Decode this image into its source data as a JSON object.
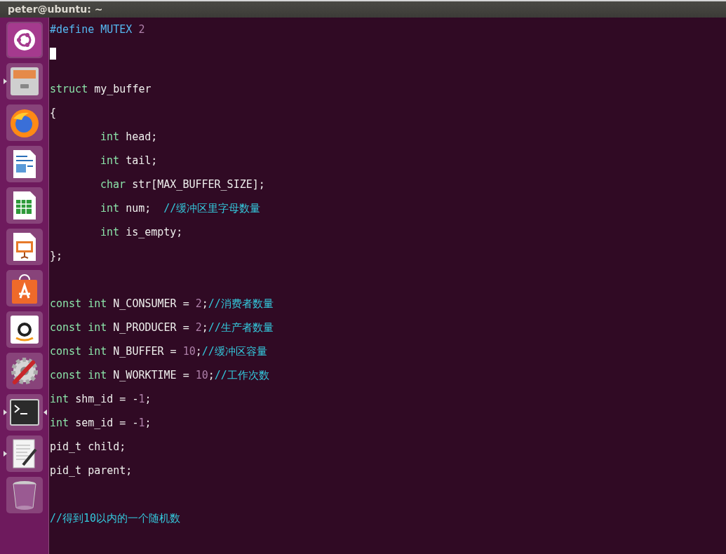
{
  "window": {
    "title": "peter@ubuntu: ~"
  },
  "launcher": [
    {
      "kind": "logo",
      "running": false,
      "focused": false
    },
    {
      "kind": "cabinet",
      "running": true,
      "focused": false
    },
    {
      "kind": "globe",
      "running": false,
      "focused": false
    },
    {
      "kind": "document",
      "running": false,
      "focused": false
    },
    {
      "kind": "spreadsheet",
      "running": false,
      "focused": false
    },
    {
      "kind": "presentation",
      "running": false,
      "focused": false
    },
    {
      "kind": "bag",
      "running": false,
      "focused": false
    },
    {
      "kind": "letter",
      "running": false,
      "focused": false
    },
    {
      "kind": "settings",
      "running": false,
      "focused": false
    },
    {
      "kind": "terminal",
      "running": true,
      "focused": true
    },
    {
      "kind": "editor",
      "running": true,
      "focused": false
    },
    {
      "kind": "trash",
      "running": false,
      "focused": false
    }
  ],
  "editor": {
    "lines": [
      {
        "kind": "code",
        "indented": false,
        "tokens": [
          {
            "kind": "preproc",
            "text": "#define MUTEX"
          },
          {
            "kind": "number",
            "text": "2"
          }
        ]
      },
      {
        "kind": "cursor"
      },
      {
        "kind": "blank"
      },
      {
        "kind": "code",
        "indented": false,
        "tokens": [
          {
            "kind": "keyword",
            "text": "struct"
          },
          {
            "kind": "plain",
            "text": "my_buffer"
          }
        ]
      },
      {
        "kind": "code",
        "indented": false,
        "tokens": [
          {
            "kind": "plain",
            "text": "{"
          }
        ]
      },
      {
        "kind": "code",
        "indented": true,
        "tokens": [
          {
            "kind": "keyword",
            "text": "int"
          },
          {
            "kind": "plain",
            "text": "head;"
          }
        ]
      },
      {
        "kind": "code",
        "indented": true,
        "tokens": [
          {
            "kind": "keyword",
            "text": "int"
          },
          {
            "kind": "plain",
            "text": "tail;"
          }
        ]
      },
      {
        "kind": "code",
        "indented": true,
        "tokens": [
          {
            "kind": "keyword",
            "text": "char"
          },
          {
            "kind": "plain",
            "text": "str[MAX_BUFFER_SIZE];"
          }
        ]
      },
      {
        "kind": "code",
        "indented": true,
        "tokens": [
          {
            "kind": "keyword",
            "text": "int"
          },
          {
            "kind": "plain",
            "text": "num;"
          },
          {
            "kind": "comment",
            "text": "//缓冲区里字母数量"
          }
        ]
      },
      {
        "kind": "code",
        "indented": true,
        "tokens": [
          {
            "kind": "keyword",
            "text": "int"
          },
          {
            "kind": "plain",
            "text": "is_empty;"
          }
        ]
      },
      {
        "kind": "code",
        "indented": false,
        "tokens": [
          {
            "kind": "plain",
            "text": "};"
          }
        ]
      },
      {
        "kind": "blank"
      },
      {
        "kind": "code",
        "indented": false,
        "tokens": [
          {
            "kind": "keyword",
            "text": "const int"
          },
          {
            "kind": "plain",
            "text": "N_CONSUMER ="
          },
          {
            "kind": "number",
            "text": "2"
          },
          {
            "kind": "punct",
            "text": ";"
          },
          {
            "kind": "comment",
            "text": "//消费者数量"
          }
        ]
      },
      {
        "kind": "code",
        "indented": false,
        "tokens": [
          {
            "kind": "keyword",
            "text": "const int"
          },
          {
            "kind": "plain",
            "text": "N_PRODUCER ="
          },
          {
            "kind": "number",
            "text": "2"
          },
          {
            "kind": "punct",
            "text": ";"
          },
          {
            "kind": "comment",
            "text": "//生产者数量"
          }
        ]
      },
      {
        "kind": "code",
        "indented": false,
        "tokens": [
          {
            "kind": "keyword",
            "text": "const int"
          },
          {
            "kind": "plain",
            "text": "N_BUFFER ="
          },
          {
            "kind": "number",
            "text": "10"
          },
          {
            "kind": "punct",
            "text": ";"
          },
          {
            "kind": "comment",
            "text": "//缓冲区容量"
          }
        ]
      },
      {
        "kind": "code",
        "indented": false,
        "tokens": [
          {
            "kind": "keyword",
            "text": "const int"
          },
          {
            "kind": "plain",
            "text": "N_WORKTIME ="
          },
          {
            "kind": "number",
            "text": "10"
          },
          {
            "kind": "punct",
            "text": ";"
          },
          {
            "kind": "comment",
            "text": "//工作次数"
          }
        ]
      },
      {
        "kind": "code",
        "indented": false,
        "tokens": [
          {
            "kind": "keyword",
            "text": "int"
          },
          {
            "kind": "plain",
            "text": "shm_id = -"
          },
          {
            "kind": "number",
            "text": "1"
          },
          {
            "kind": "punct",
            "text": ";"
          }
        ]
      },
      {
        "kind": "code",
        "indented": false,
        "tokens": [
          {
            "kind": "keyword",
            "text": "int"
          },
          {
            "kind": "plain",
            "text": "sem_id = -"
          },
          {
            "kind": "number",
            "text": "1"
          },
          {
            "kind": "punct",
            "text": ";"
          }
        ]
      },
      {
        "kind": "code",
        "indented": false,
        "tokens": [
          {
            "kind": "plain",
            "text": "pid_t child;"
          }
        ]
      },
      {
        "kind": "code",
        "indented": false,
        "tokens": [
          {
            "kind": "plain",
            "text": "pid_t parent;"
          }
        ]
      },
      {
        "kind": "blank"
      },
      {
        "kind": "code",
        "indented": false,
        "tokens": [
          {
            "kind": "comment",
            "text": "//得到10以内的一个随机数"
          }
        ]
      }
    ]
  }
}
